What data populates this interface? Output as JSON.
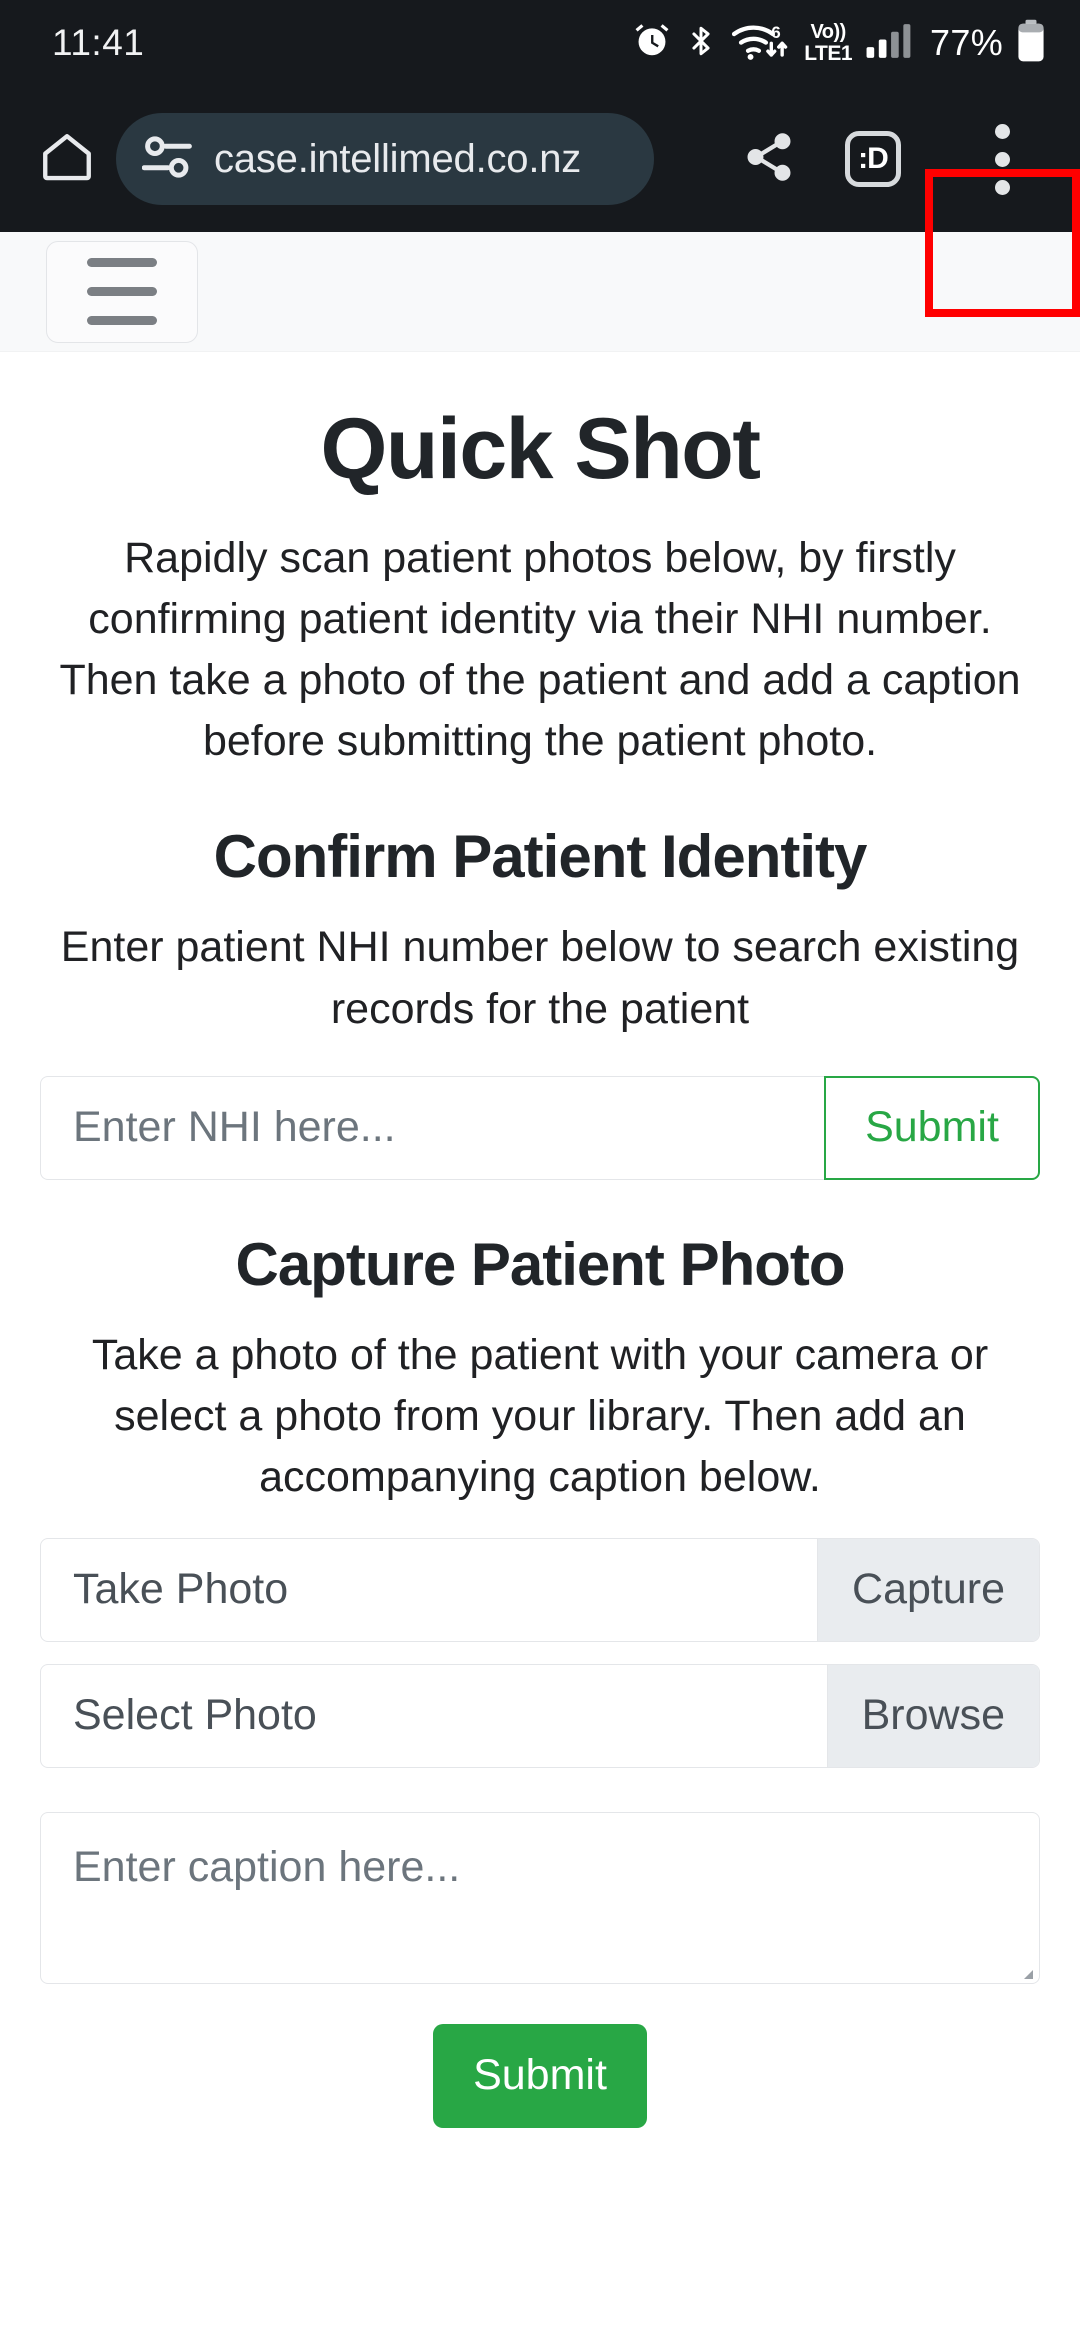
{
  "status_bar": {
    "time": "11:41",
    "battery_percent": "77%",
    "volte_top": "Vo))",
    "volte_bottom": "LTE1",
    "wifi_gen": "6",
    "icons": [
      "alarm-icon",
      "bluetooth-icon",
      "wifi-icon",
      "volte-icon",
      "signal-icon",
      "battery-icon"
    ]
  },
  "browser": {
    "url": "case.intellimed.co.nz",
    "tab_count_label": ":D",
    "icons": [
      "home-icon",
      "page-info-tune-icon",
      "share-icon",
      "tab-counter-icon",
      "overflow-menu-icon"
    ],
    "highlight_color": "#ff0000"
  },
  "page": {
    "title": "Quick Shot",
    "intro": "Rapidly scan patient photos below, by firstly confirming patient identity via their NHI number. Then take a photo of the patient and add a caption before submitting the patient photo.",
    "identity": {
      "heading": "Confirm Patient Identity",
      "description": "Enter patient NHI number below to search existing records for the patient",
      "nhi_placeholder": "Enter NHI here...",
      "nhi_value": "",
      "submit_label": "Submit"
    },
    "capture": {
      "heading": "Capture Patient Photo",
      "description": "Take a photo of the patient with your camera or select a photo from your library. Then add an accompanying caption below.",
      "take_photo_label": "Take Photo",
      "capture_button": "Capture",
      "select_photo_label": "Select Photo",
      "browse_button": "Browse",
      "caption_placeholder": "Enter caption here...",
      "caption_value": "",
      "submit_label": "Submit"
    }
  },
  "colors": {
    "brand_green": "#28a745",
    "toolbar_dark": "#16191d",
    "url_pill": "#2a3841",
    "navbar_bg": "#f8f9fa",
    "highlight_red": "#ff0000"
  }
}
